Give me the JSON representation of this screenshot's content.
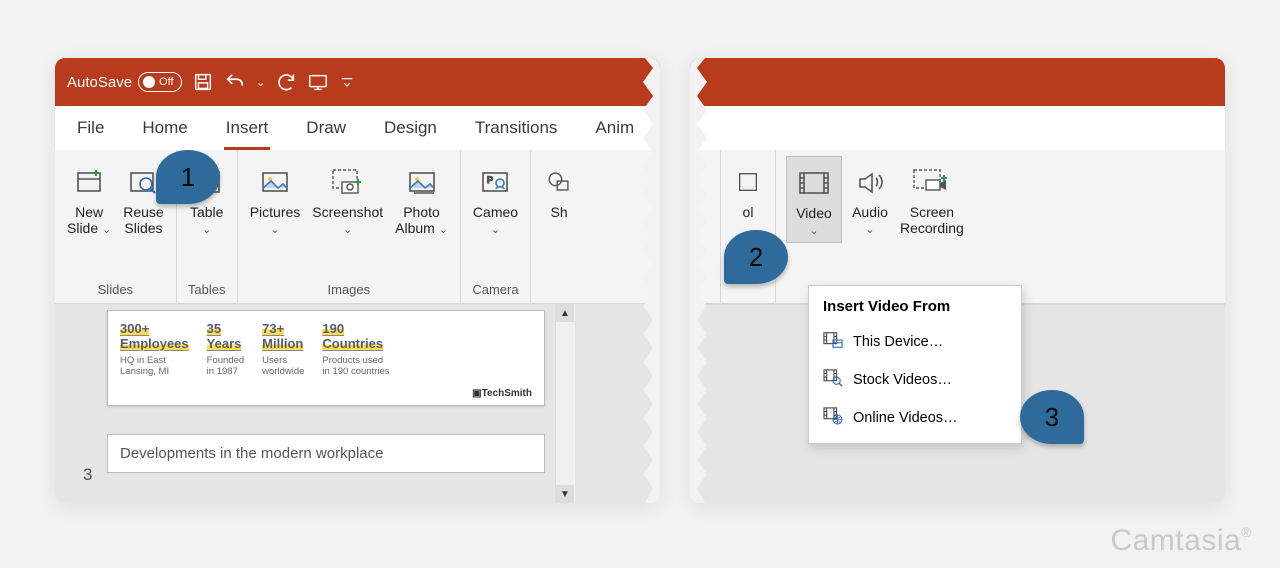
{
  "titlebar": {
    "autosave_label": "AutoSave",
    "autosave_state": "Off"
  },
  "tabs": [
    "File",
    "Home",
    "Insert",
    "Draw",
    "Design",
    "Transitions",
    "Anim"
  ],
  "active_tab": "Insert",
  "groups": {
    "slides": {
      "label": "Slides",
      "new_slide": "New\nSlide",
      "reuse_slides": "Reuse\nSlides"
    },
    "tables": {
      "label": "Tables",
      "table": "Table"
    },
    "images": {
      "label": "Images",
      "pictures": "Pictures",
      "screenshot": "Screenshot",
      "photo_album": "Photo\nAlbum"
    },
    "camera": {
      "label": "Camera",
      "cameo": "Cameo"
    },
    "right_partial": {
      "sh": "Sh",
      "ol_suffix": "ol"
    },
    "media": {
      "video": "Video",
      "audio": "Audio",
      "screen_recording": "Screen\nRecording"
    }
  },
  "slide": {
    "stats": [
      {
        "big": "300+",
        "line2": "Employees",
        "sub": "HQ in East\nLansing, MI"
      },
      {
        "big": "35",
        "line2": "Years",
        "sub": "Founded\nin 1987"
      },
      {
        "big": "73+",
        "line2": "Million",
        "sub": "Users\nworldwide"
      },
      {
        "big": "190",
        "line2": "Countries",
        "sub": "Products used\nin 190 countries"
      }
    ],
    "brand": "▣TechSmith",
    "next_num": "3",
    "next_title": "Developments in the modern workplace"
  },
  "dropdown": {
    "title": "Insert Video From",
    "items": [
      {
        "label": "This Device…",
        "ukey": "T"
      },
      {
        "label": "Stock Videos…",
        "ukey": "S"
      },
      {
        "label": "Online Videos…",
        "ukey": "O"
      }
    ]
  },
  "annotations": {
    "a1": "1",
    "a2": "2",
    "a3": "3"
  },
  "watermark": "Camtasia"
}
